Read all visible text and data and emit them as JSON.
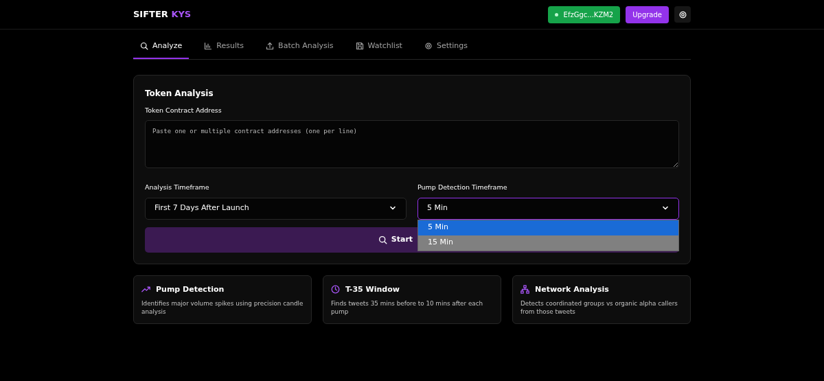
{
  "brand": {
    "name": "SIFTER",
    "accent": "KYS"
  },
  "header": {
    "wallet": "EfzGgc...KZM2",
    "upgrade": "Upgrade"
  },
  "tabs": [
    {
      "label": "Analyze",
      "selected": true
    },
    {
      "label": "Results",
      "selected": false
    },
    {
      "label": "Batch Analysis",
      "selected": false
    },
    {
      "label": "Watchlist",
      "selected": false
    },
    {
      "label": "Settings",
      "selected": false
    }
  ],
  "analysis": {
    "title": "Token Analysis",
    "address_label": "Token Contract Address",
    "address_placeholder": "Paste one or multiple contract addresses (one per line)",
    "timeframe_label": "Analysis Timeframe",
    "timeframe_value": "First 7 Days After Launch",
    "pump_label": "Pump Detection Timeframe",
    "pump_value": "5 Min",
    "pump_options": [
      {
        "label": "5 Min",
        "selected": true
      },
      {
        "label": "15 Min",
        "selected": false
      }
    ],
    "start_button": "Start"
  },
  "features": [
    {
      "title": "Pump Detection",
      "text": "Identifies major volume spikes using precision candle analysis"
    },
    {
      "title": "T-35 Window",
      "text": "Finds tweets 35 mins before to 10 mins after each pump"
    },
    {
      "title": "Network Analysis",
      "text": "Detects coordinated groups vs organic alpha callers from those tweets"
    }
  ]
}
